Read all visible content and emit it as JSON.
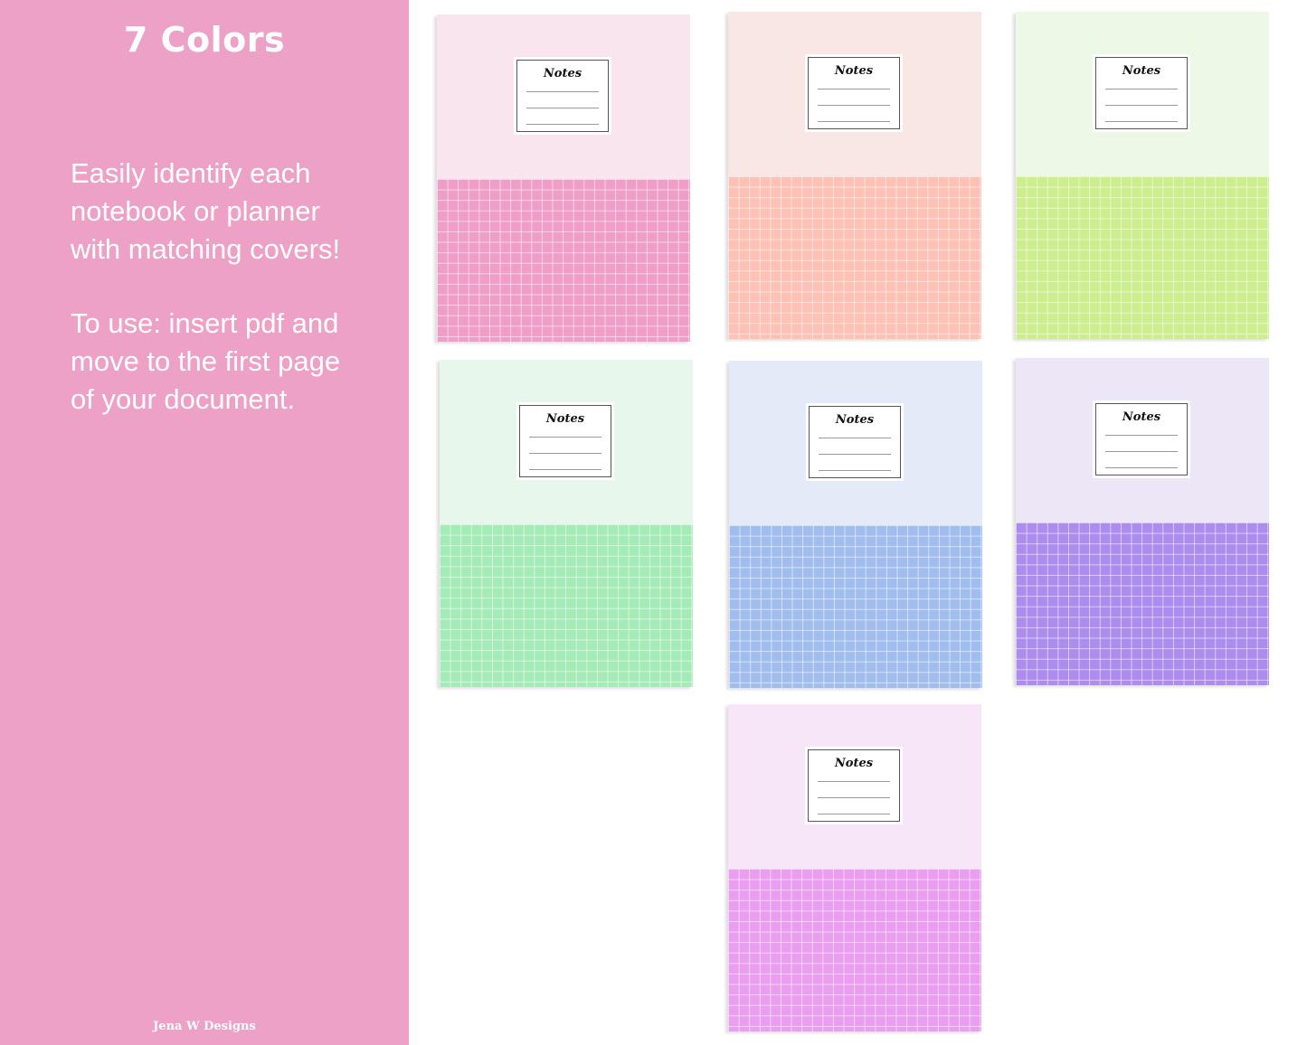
{
  "sidebar": {
    "title": "7 Colors",
    "paragraph1": "Easily identify each\nnotebook or planner\nwith matching covers!",
    "paragraph2": "To use: insert pdf and\nmove to the first  page\nof your document.",
    "footer": "Jena W Designs",
    "background_color": "#eea1c6"
  },
  "covers": [
    {
      "label": "Notes",
      "top_color": "#f9e5ee",
      "grid_color": "#ef9ec8"
    },
    {
      "label": "Notes",
      "top_color": "#f8e7e4",
      "grid_color": "#fdc2b5"
    },
    {
      "label": "Notes",
      "top_color": "#eef8e6",
      "grid_color": "#cdee8e"
    },
    {
      "label": "Notes",
      "top_color": "#e7f7ec",
      "grid_color": "#a5ebb7"
    },
    {
      "label": "Notes",
      "top_color": "#e4eaf8",
      "grid_color": "#a1bdee"
    },
    {
      "label": "Notes",
      "top_color": "#ede6f7",
      "grid_color": "#ac8ded"
    },
    {
      "label": "Notes",
      "top_color": "#f7e6f7",
      "grid_color": "#e99ef0"
    }
  ]
}
